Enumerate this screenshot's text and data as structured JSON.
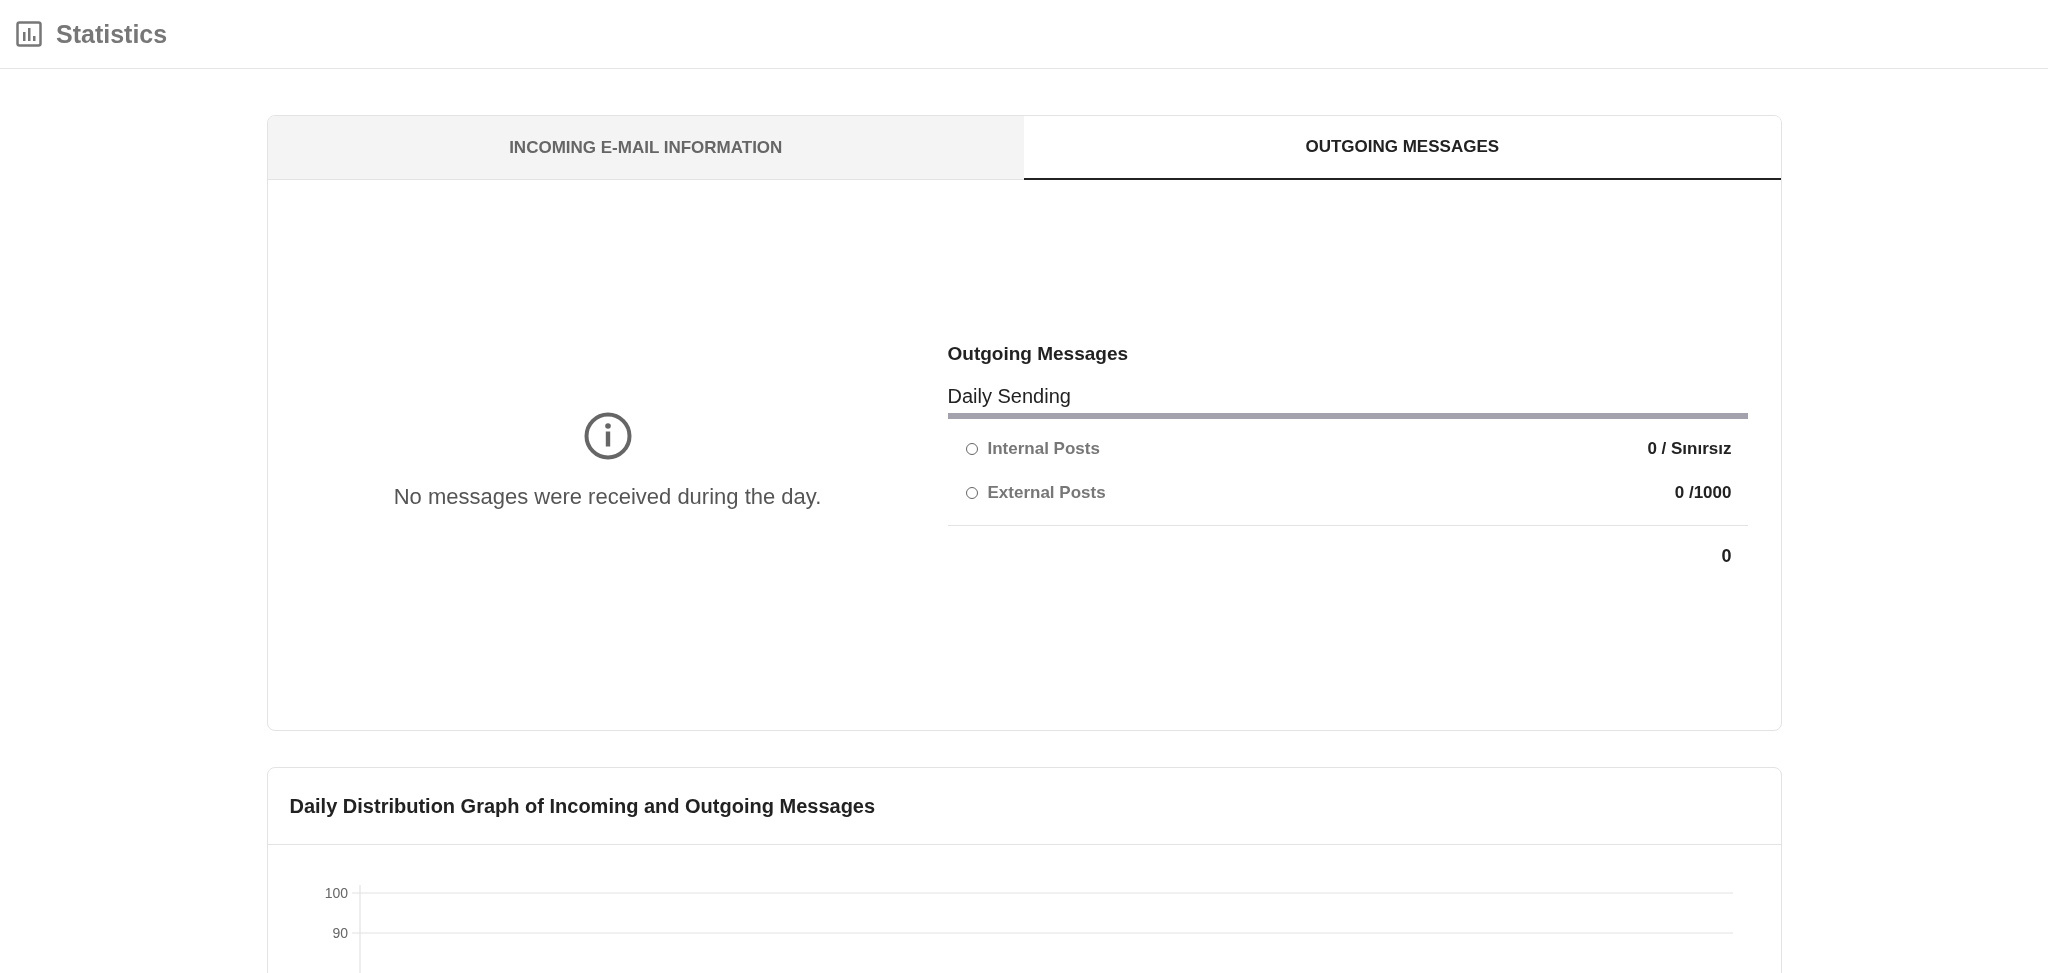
{
  "header": {
    "title": "Statistics"
  },
  "tabs": [
    {
      "label": "INCOMING E-MAIL INFORMATION",
      "selected": false
    },
    {
      "label": "OUTGOING MESSAGES",
      "selected": true
    }
  ],
  "incoming": {
    "message": "No messages were received during the day."
  },
  "outgoing": {
    "title": "Outgoing Messages",
    "subtitle": "Daily Sending",
    "rows": [
      {
        "label": "Internal Posts",
        "value": "0 / Sınırsız",
        "selected": false
      },
      {
        "label": "External Posts",
        "value": "0 /1000",
        "selected": false
      }
    ],
    "total": "0"
  },
  "graph": {
    "title": "Daily Distribution Graph of Incoming and Outgoing Messages",
    "axis_labels": [
      "100",
      "90"
    ]
  }
}
